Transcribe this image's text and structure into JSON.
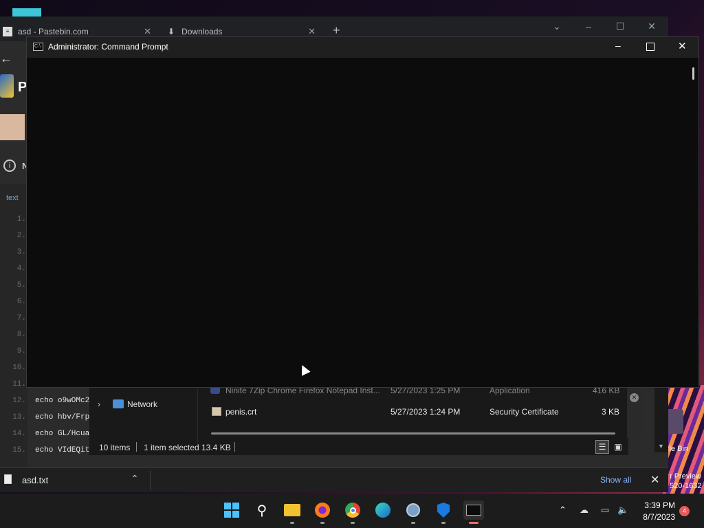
{
  "browser": {
    "tabs": [
      {
        "title": "asd - Pastebin.com",
        "icon": "pastebin-icon"
      },
      {
        "title": "Downloads",
        "icon": "download-icon"
      }
    ],
    "page": {
      "logo_letter": "P",
      "info_letter": "N",
      "syntax_label": "text",
      "line_numbers": [
        "1.",
        "2.",
        "3.",
        "4.",
        "5.",
        "6.",
        "7.",
        "8.",
        "9.",
        "10.",
        "11.",
        "12.",
        "13.",
        "14.",
        "15."
      ],
      "code_lines": [
        "echo o9wOMc2",
        "echo hbv/Frp",
        "echo GL/Hcua",
        "echo VIdEQit"
      ]
    },
    "download_bar": {
      "file_name": "asd.txt",
      "show_all": "Show all"
    }
  },
  "cmd": {
    "title": "Administrator: Command Prompt"
  },
  "explorer": {
    "nav_item": "Network",
    "files": [
      {
        "name": "Ninite 7Zip Chrome Firefox Notepad Inst...",
        "date": "5/27/2023 1:25 PM",
        "type": "Application",
        "size": "416 KB"
      },
      {
        "name": "penis.crt",
        "date": "5/27/2023 1:24 PM",
        "type": "Security Certificate",
        "size": "3 KB"
      }
    ],
    "status": {
      "items": "10 items",
      "selected": "1 item selected",
      "size": "13.4 KB"
    }
  },
  "desktop": {
    "recycle_label": "cle Bin",
    "preview_lines": [
      "r Preview",
      "520-1632"
    ]
  },
  "taskbar": {
    "time": "3:39 PM",
    "date": "8/7/2023",
    "notification_count": "4"
  }
}
